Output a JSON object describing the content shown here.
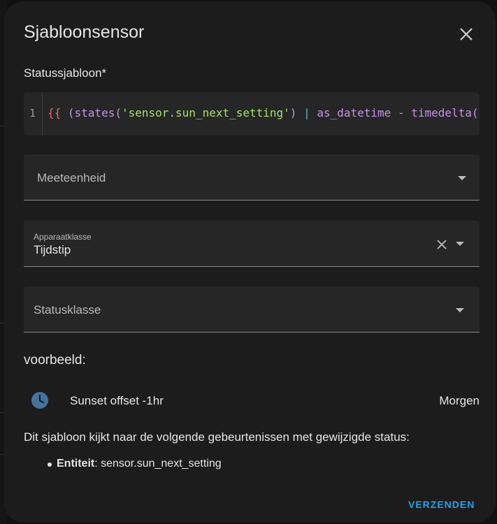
{
  "dialog": {
    "title": "Sjabloonsensor",
    "close_icon": "close-icon"
  },
  "template": {
    "label": "Statussjabloon*",
    "line_number": "1",
    "tokens": {
      "brace": "{{",
      "open": " (states(",
      "string": "'sensor.sun_next_setting'",
      "close": ")",
      "pipe": " | ",
      "rest": "as_datetime - timedelta(ho"
    }
  },
  "fields": {
    "unit": {
      "label": "Meeteenheid",
      "value": ""
    },
    "device_class": {
      "label": "Apparaatklasse",
      "value": "Tijdstip"
    },
    "state_class": {
      "label": "Statusklasse",
      "value": ""
    }
  },
  "preview": {
    "heading": "voorbeeld:",
    "icon": "clock-icon",
    "name": "Sunset offset -1hr",
    "state": "Morgen",
    "info": "Dit sjabloon kijkt naar de volgende gebeurtenissen met gewijzigde status:",
    "entity_label": "Entiteit",
    "entity_value": ": sensor.sun_next_setting"
  },
  "actions": {
    "submit_label": "VERZENDEN"
  },
  "colors": {
    "accent": "#2e9ee6",
    "clock": "#44739e"
  }
}
